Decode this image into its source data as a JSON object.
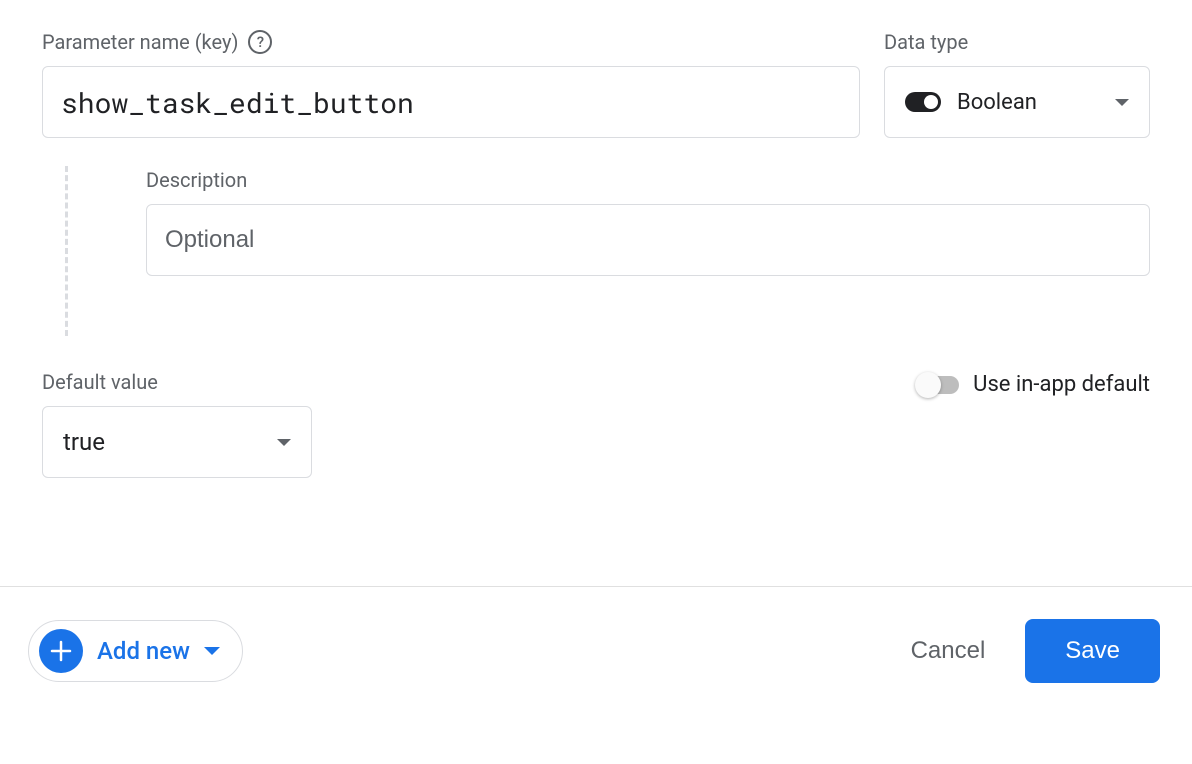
{
  "parameter": {
    "label": "Parameter name (key)",
    "value": "show_task_edit_button"
  },
  "datatype": {
    "label": "Data type",
    "value": "Boolean"
  },
  "description": {
    "label": "Description",
    "placeholder": "Optional",
    "value": ""
  },
  "default_value": {
    "label": "Default value",
    "value": "true"
  },
  "inapp": {
    "label": "Use in-app default",
    "enabled": false
  },
  "footer": {
    "add_new": "Add new",
    "cancel": "Cancel",
    "save": "Save"
  }
}
